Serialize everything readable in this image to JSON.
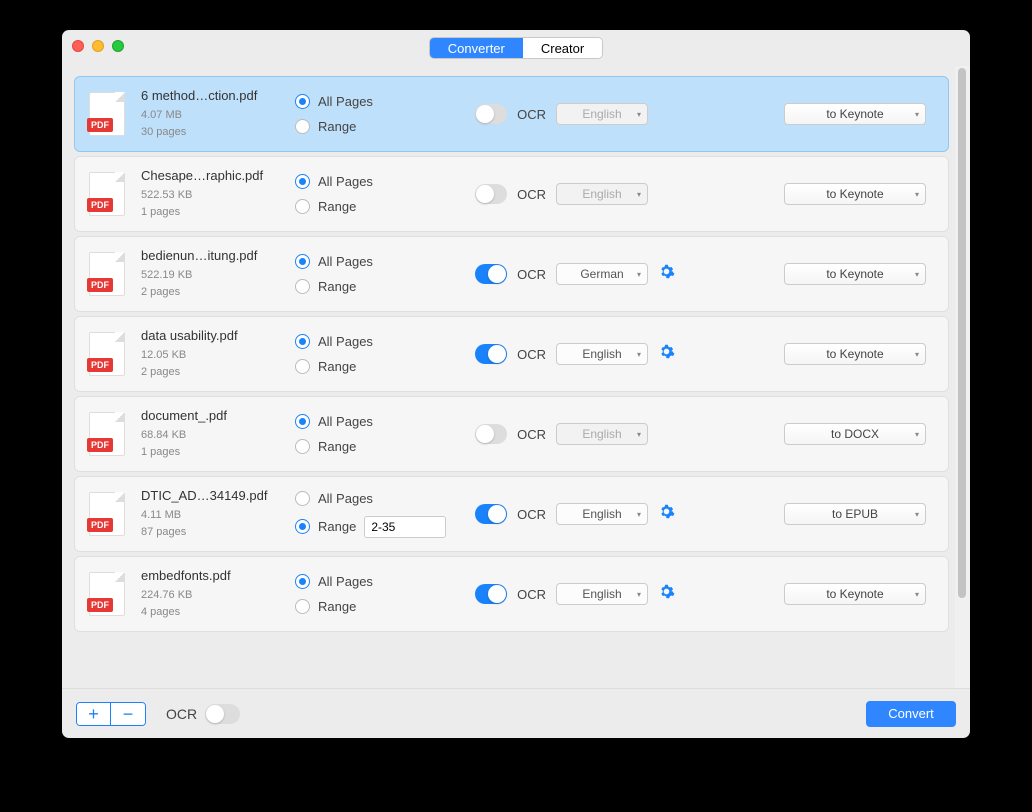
{
  "tabs": {
    "converter": "Converter",
    "creator": "Creator"
  },
  "labels": {
    "allpages": "All Pages",
    "range": "Range",
    "ocr": "OCR",
    "footer_ocr": "OCR",
    "convert": "Convert",
    "pdf": "PDF"
  },
  "files": [
    {
      "name": "6 method…ction.pdf",
      "size": "4.07 MB",
      "pages": "30 pages",
      "selected": true,
      "rangeSel": "all",
      "rangeVal": "",
      "ocr": false,
      "lang": "English",
      "format": "to Keynote"
    },
    {
      "name": "Chesape…raphic.pdf",
      "size": "522.53 KB",
      "pages": "1 pages",
      "selected": false,
      "rangeSel": "all",
      "rangeVal": "",
      "ocr": false,
      "lang": "English",
      "format": "to Keynote"
    },
    {
      "name": "bedienun…itung.pdf",
      "size": "522.19 KB",
      "pages": "2 pages",
      "selected": false,
      "rangeSel": "all",
      "rangeVal": "",
      "ocr": true,
      "lang": "German",
      "format": "to Keynote"
    },
    {
      "name": "data usability.pdf",
      "size": "12.05 KB",
      "pages": "2 pages",
      "selected": false,
      "rangeSel": "all",
      "rangeVal": "",
      "ocr": true,
      "lang": "English",
      "format": "to Keynote"
    },
    {
      "name": "document_.pdf",
      "size": "68.84 KB",
      "pages": "1 pages",
      "selected": false,
      "rangeSel": "all",
      "rangeVal": "",
      "ocr": false,
      "lang": "English",
      "format": "to DOCX"
    },
    {
      "name": "DTIC_AD…34149.pdf",
      "size": "4.11 MB",
      "pages": "87 pages",
      "selected": false,
      "rangeSel": "range",
      "rangeVal": "2-35",
      "ocr": true,
      "lang": "English",
      "format": "to EPUB"
    },
    {
      "name": "embedfonts.pdf",
      "size": "224.76 KB",
      "pages": "4 pages",
      "selected": false,
      "rangeSel": "all",
      "rangeVal": "",
      "ocr": true,
      "lang": "English",
      "format": "to Keynote"
    }
  ]
}
